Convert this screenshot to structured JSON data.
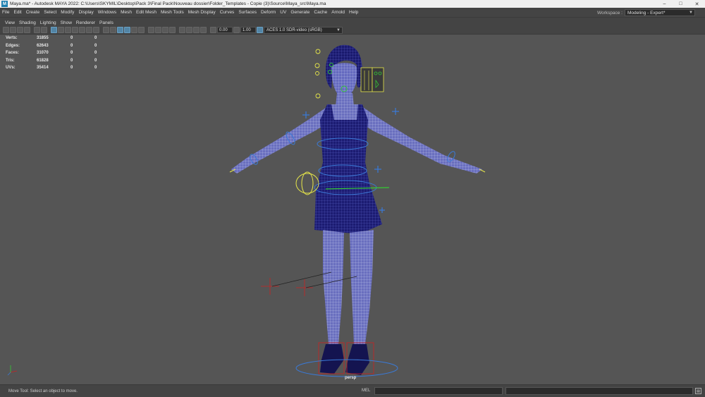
{
  "window": {
    "title": "Maya.ma* - Autodesk MAYA 2022: C:\\Users\\SKYMIL\\Desktop\\Pack 3\\Final Pack\\Nouveau dossier\\Folder_Templates - Copie (3)\\Source\\Maya_src\\Maya.ma",
    "app_letter": "M",
    "controls": {
      "minimize": "–",
      "maximize": "□",
      "close": "✕"
    }
  },
  "menubar": {
    "items": [
      "File",
      "Edit",
      "Create",
      "Select",
      "Modify",
      "Display",
      "Windows",
      "Mesh",
      "Edit Mesh",
      "Mesh Tools",
      "Mesh Display",
      "Curves",
      "Surfaces",
      "Deform",
      "UV",
      "Generate",
      "Cache",
      "Arnold",
      "Help"
    ],
    "workspace_label": "Workspace :",
    "workspace_value": "Modeling - Expert*"
  },
  "panel_menu": {
    "items": [
      "View",
      "Shading",
      "Lighting",
      "Show",
      "Renderer",
      "Panels"
    ]
  },
  "toolbar": {
    "exposure": "0.00",
    "gamma": "1.00",
    "color_space": "ACES 1.0 SDR-video (sRGB)"
  },
  "hud": {
    "rows": [
      {
        "label": "Verts:",
        "value": "31855",
        "c2": "0",
        "c3": "0"
      },
      {
        "label": "Edges:",
        "value": "62643",
        "c2": "0",
        "c3": "0"
      },
      {
        "label": "Faces:",
        "value": "31070",
        "c2": "0",
        "c3": "0"
      },
      {
        "label": "Tris:",
        "value": "61828",
        "c2": "0",
        "c3": "0"
      },
      {
        "label": "UVs:",
        "value": "35414",
        "c2": "0",
        "c3": "0"
      }
    ]
  },
  "viewport": {
    "camera": "persp",
    "background_color": "#555555",
    "mesh_color": "#1a1a6e",
    "wire_color": "#cfd2f0",
    "control_color": "#3a7ad8",
    "ik_color": "#cc2222",
    "selected_color": "#e6e64a"
  },
  "statusbar": {
    "help_text": "Move Tool: Select an object to move.",
    "mel_label": "MEL"
  }
}
